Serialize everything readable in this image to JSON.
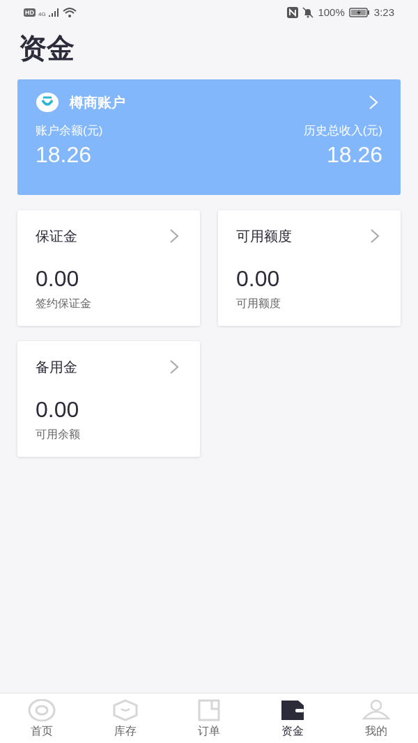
{
  "status_bar": {
    "network_badge": "HD",
    "network_type": "4G",
    "battery": "100%",
    "time": "3:23"
  },
  "page_title": "资金",
  "account_card": {
    "name": "樽商账户",
    "balance_label": "账户余额(元)",
    "balance": "18.26",
    "income_label": "历史总收入(元)",
    "income": "18.26"
  },
  "fund_cards": [
    {
      "title": "保证金",
      "amount": "0.00",
      "caption": "签约保证金"
    },
    {
      "title": "可用额度",
      "amount": "0.00",
      "caption": "可用额度"
    },
    {
      "title": "备用金",
      "amount": "0.00",
      "caption": "可用余额"
    }
  ],
  "tab_bar": [
    {
      "kind": "home",
      "label": "首页",
      "selected": false
    },
    {
      "kind": "stock",
      "label": "库存",
      "selected": false
    },
    {
      "kind": "orders",
      "label": "订单",
      "selected": false
    },
    {
      "kind": "funds",
      "label": "资金",
      "selected": true
    },
    {
      "kind": "me",
      "label": "我的",
      "selected": false
    }
  ]
}
